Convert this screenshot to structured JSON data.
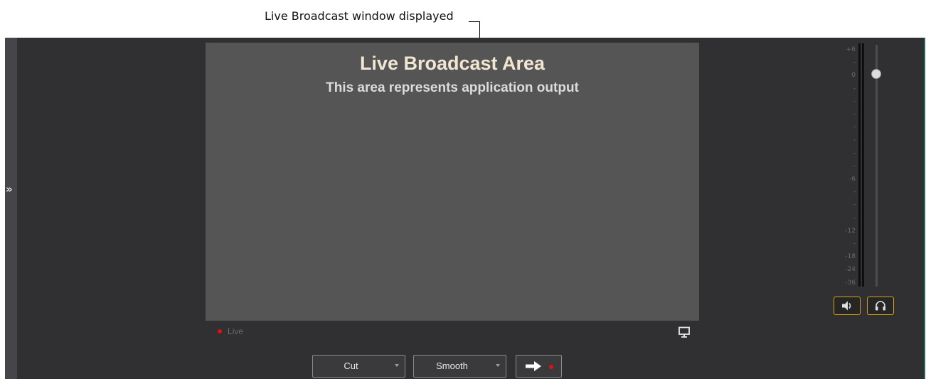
{
  "annotation": {
    "callout_text": "Live Broadcast window displayed"
  },
  "broadcast": {
    "title": "Live Broadcast Area",
    "subtitle": "This area represents application output"
  },
  "status": {
    "live_label": "Live",
    "live_color": "#e01010"
  },
  "controls": {
    "transition_label": "Cut",
    "smoothing_label": "Smooth",
    "go_icon": "arrow-right-icon"
  },
  "meter": {
    "scale_labels": [
      "+6",
      "-",
      "0",
      "-",
      "-",
      "-",
      "-",
      "-",
      "-",
      "-",
      "-6",
      "-",
      "-",
      "-",
      "-12",
      "-",
      "-18",
      "-24",
      "-36"
    ],
    "volume_level": 0.88
  },
  "audio_buttons": {
    "speaker_icon": "speaker-icon",
    "headphone_icon": "headphone-icon",
    "accent_color": "#d8a019"
  },
  "icons": {
    "expand": "double-chevron-right-icon",
    "monitor": "monitor-icon"
  }
}
